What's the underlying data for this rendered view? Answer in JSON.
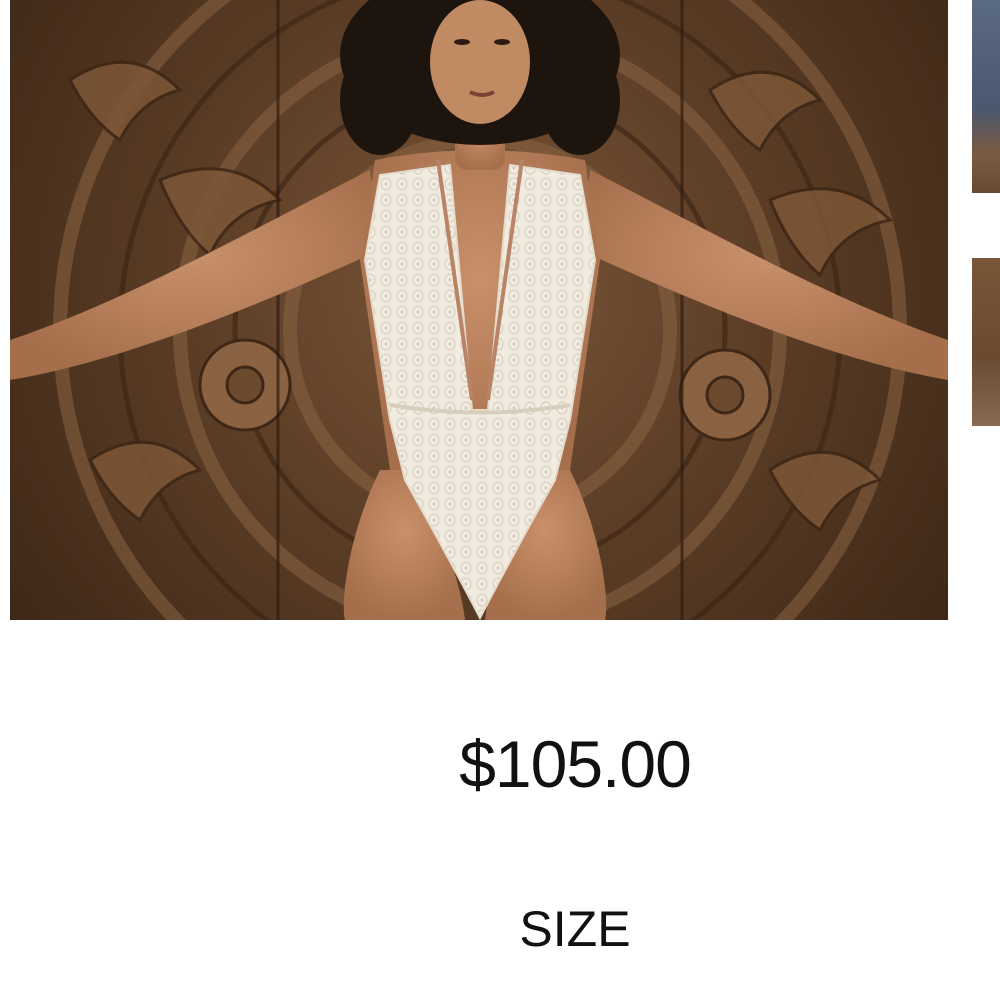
{
  "product": {
    "price": "$105.00",
    "size_label": "SIZE"
  },
  "images": {
    "main": "carved-wood-panel-lace-bodysuit-photo",
    "thumbnails": [
      "thumbnail-1",
      "thumbnail-2"
    ]
  },
  "colors": {
    "text": "#111111",
    "background": "#ffffff",
    "wood": "#6b4a2e",
    "garment": "#f2ece2"
  }
}
